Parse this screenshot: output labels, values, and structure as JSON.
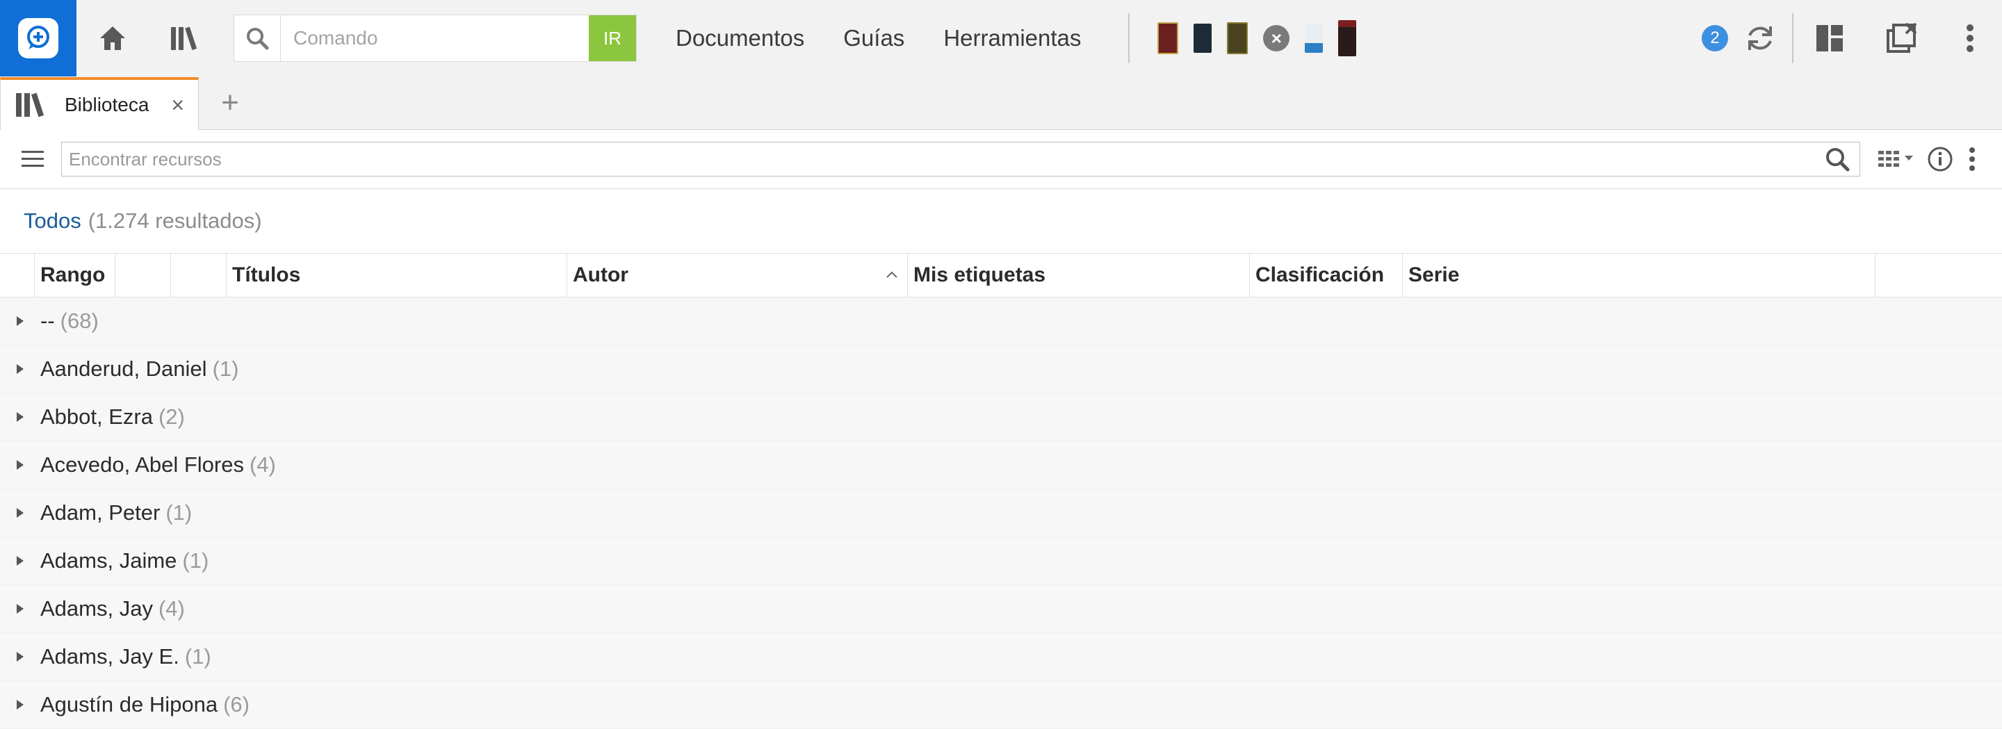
{
  "topbar": {
    "command_placeholder": "Comando",
    "go_label": "IR",
    "menu": [
      "Documentos",
      "Guías",
      "Herramientas"
    ],
    "notification_count": "2"
  },
  "tabs": [
    {
      "label": "Biblioteca",
      "close": "×"
    }
  ],
  "tab_add": "+",
  "search": {
    "placeholder": "Encontrar recursos"
  },
  "filter": {
    "label": "Todos",
    "count": "(1.274 resultados)"
  },
  "columns": [
    "Rango",
    "",
    "",
    "Títulos",
    "Autor",
    "Mis etiquetas",
    "Clasificación",
    "Serie",
    ""
  ],
  "rows": [
    {
      "name": "--",
      "count": "(68)"
    },
    {
      "name": "Aanderud, Daniel",
      "count": "(1)"
    },
    {
      "name": "Abbot, Ezra",
      "count": "(2)"
    },
    {
      "name": "Acevedo, Abel Flores",
      "count": "(4)"
    },
    {
      "name": "Adam, Peter",
      "count": "(1)"
    },
    {
      "name": "Adams, Jaime",
      "count": "(1)"
    },
    {
      "name": "Adams, Jay",
      "count": "(4)"
    },
    {
      "name": "Adams, Jay E.",
      "count": "(1)"
    },
    {
      "name": "Agustín de Hipona",
      "count": "(6)"
    }
  ],
  "colors": {
    "brand": "#0f6fd6",
    "go": "#8cc63f",
    "tab_accent": "#f28b2b",
    "link": "#1a5d9a"
  },
  "recent_books": [
    "book-1",
    "book-2",
    "book-3",
    "close-recent",
    "book-4",
    "book-5"
  ]
}
